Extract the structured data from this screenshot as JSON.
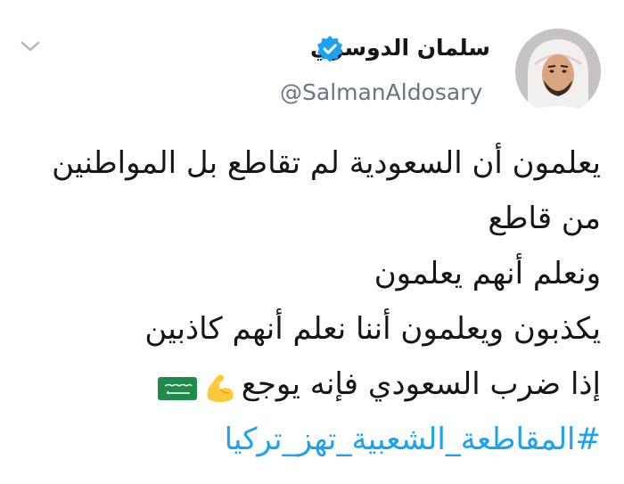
{
  "tweet": {
    "author": {
      "name": "سلمان الدوسري",
      "handle": "@SalmanAldosary",
      "verified": true
    },
    "body": {
      "line1": "يعلمون أن السعودية لم تقاطع بل المواطنين",
      "line2": "من قاطع",
      "line3": "ونعلم أنهم يعلمون",
      "line4": "يكذبون ويعلمون أننا نعلم أنهم كاذبين",
      "line5": "إذا ضرب السعودي فإنه يوجع",
      "line5_emojis": [
        "flexed-biceps",
        "saudi-arabia-flag"
      ],
      "hashtag": "#المقاطعة_الشعبية_تهز_تركيا"
    },
    "colors": {
      "text": "#14171a",
      "secondary": "#657786",
      "link": "#1da1f2",
      "verified": "#1da1f2"
    }
  }
}
